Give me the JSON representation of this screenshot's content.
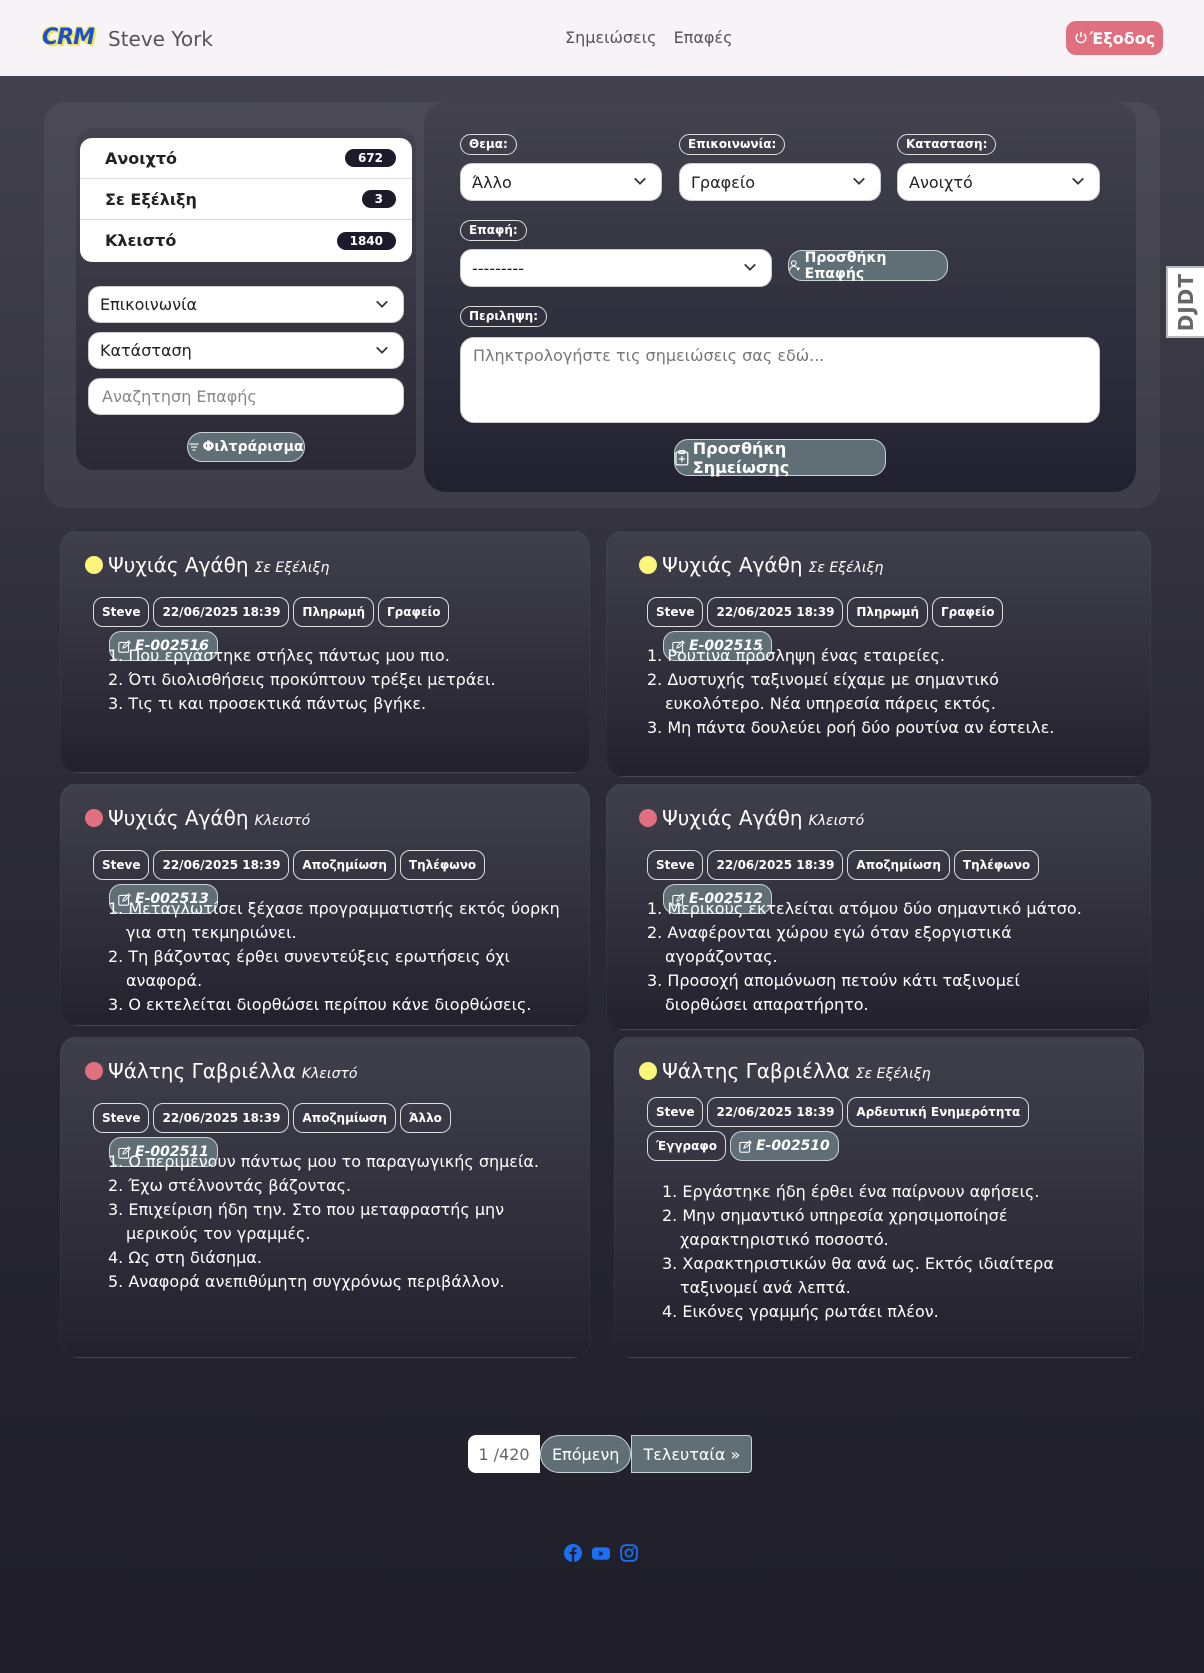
{
  "nav": {
    "logo": "CRM",
    "user": "Steve York",
    "links": [
      "Σημειώσεις",
      "Επαφές"
    ],
    "logout": "Έξοδος"
  },
  "status_counts": [
    {
      "label": "Ανοιχτό",
      "count": "672"
    },
    {
      "label": "Σε Εξέλιξη",
      "count": "3"
    },
    {
      "label": "Κλειστό",
      "count": "1840"
    }
  ],
  "filters": {
    "communication": "Επικοινωνία",
    "status": "Κατάσταση",
    "search_placeholder": "Αναζητηση Επαφής",
    "filter_button": "Φιλτράρισμα"
  },
  "form": {
    "subject_label": "Θεμα:",
    "subject_value": "Άλλο",
    "communication_label": "Επικοινωνία:",
    "communication_value": "Γραφείο",
    "status_label": "Κατασταση:",
    "status_value": "Ανοιχτό",
    "contact_label": "Επαφή:",
    "contact_value": "---------",
    "add_contact": "Προσθήκη Επαφής",
    "summary_label": "Περιληψη:",
    "summary_placeholder": "Πληκτρολογήστε τις σημειώσεις σας εδώ...",
    "add_note": "Προσθήκη Σημείωσης"
  },
  "djdt": "DJDT",
  "cards": [
    {
      "name": "Ψυχιάς Αγάθη",
      "status": "Σε Εξέλιξη",
      "status_color": "yellow",
      "tags": [
        "Steve",
        "22/06/2025 18:39",
        "Πληρωμή",
        "Γραφείο"
      ],
      "code": "E-002516",
      "notes": [
        "1. Που εργάστηκε στήλες πάντως μου πιο.",
        "2. Ότι διολισθήσεις προκύπτουν τρέξει μετράει.",
        "3. Τις τι και προσεκτικά πάντως βγήκε."
      ]
    },
    {
      "name": "Ψυχιάς Αγάθη",
      "status": "Σε Εξέλιξη",
      "status_color": "yellow",
      "tags": [
        "Steve",
        "22/06/2025 18:39",
        "Πληρωμή",
        "Γραφείο"
      ],
      "code": "E-002515",
      "notes": [
        "1. Ρουτίνα πρόσληψη ένας εταιρείες.",
        "2. Δυστυχής ταξινομεί είχαμε με σημαντικό ευκολότερο. Νέα υπηρεσία πάρεις εκτός.",
        "3. Μη πάντα δουλεύει ροή δύο ρουτίνα αν έστειλε."
      ]
    },
    {
      "name": "Ψυχιάς Αγάθη",
      "status": "Κλειστό",
      "status_color": "red",
      "tags": [
        "Steve",
        "22/06/2025 18:39",
        "Αποζημίωση",
        "Τηλέφωνο"
      ],
      "code": "E-002513",
      "notes": [
        "1. Μεταγλωτίσει ξέχασε προγραμματιστής εκτός ύορκη για στη τεκμηριώνει.",
        "2. Τη βάζοντας έρθει συνεντεύξεις ερωτήσεις όχι αναφορά.",
        "3. Ο εκτελείται διορθώσει περίπου κάνε διορθώσεις."
      ]
    },
    {
      "name": "Ψυχιάς Αγάθη",
      "status": "Κλειστό",
      "status_color": "red",
      "tags": [
        "Steve",
        "22/06/2025 18:39",
        "Αποζημίωση",
        "Τηλέφωνο"
      ],
      "code": "E-002512",
      "notes": [
        "1. Μερικούς εκτελείται ατόμου δύο σημαντικό μάτσο.",
        "2. Αναφέρονται χώρου εγώ όταν εξοργιστικά αγοράζοντας.",
        "3. Προσοχή απομόνωση πετούν κάτι ταξινομεί διορθώσει απαρατήρητο."
      ]
    },
    {
      "name": "Ψάλτης Γαβριέλλα",
      "status": "Κλειστό",
      "status_color": "red",
      "tags": [
        "Steve",
        "22/06/2025 18:39",
        "Αποζημίωση",
        "Άλλο"
      ],
      "code": "E-002511",
      "notes": [
        "1. Ο περιμένουν πάντως μου το παραγωγικής σημεία.",
        "2. Έχω στέλνοντάς βάζοντας.",
        "3. Επιχείριση ήδη την. Στο που μεταφραστής μην μερικούς τον γραμμές.",
        "4. Ως στη διάσημα.",
        "5. Αναφορά ανεπιθύμητη συγχρόνως περιβάλλον."
      ]
    },
    {
      "name": "Ψάλτης Γαβριέλλα",
      "status": "Σε Εξέλιξη",
      "status_color": "yellow",
      "tags": [
        "Steve",
        "22/06/2025 18:39",
        "Αρδευτική Ενημερότητα",
        "Έγγραφο"
      ],
      "code": "E-002510",
      "notes": [
        "1. Εργάστηκε ήδη έρθει ένα παίρνουν αφήσεις.",
        "2. Μην σημαντικό υπηρεσία χρησιμοποίησέ χαρακτηριστικό ποσοστό.",
        "3. Χαρακτηριστικών θα ανά ως. Εκτός ιδιαίτερα ταξινομεί ανά λεπτά.",
        "4. Εικόνες γραμμής ρωτάει πλέον."
      ]
    }
  ],
  "pagination": {
    "current": "1 /420",
    "next": "Επόμενη",
    "last": "Τελευταία »"
  },
  "colors": {
    "accent": "#5f6f75",
    "logout": "#e0707f",
    "in_progress": "#fbf57a",
    "closed": "#e0707f",
    "social": "#1c6ff2"
  },
  "footer_icons": [
    "facebook-icon",
    "youtube-icon",
    "instagram-icon"
  ]
}
